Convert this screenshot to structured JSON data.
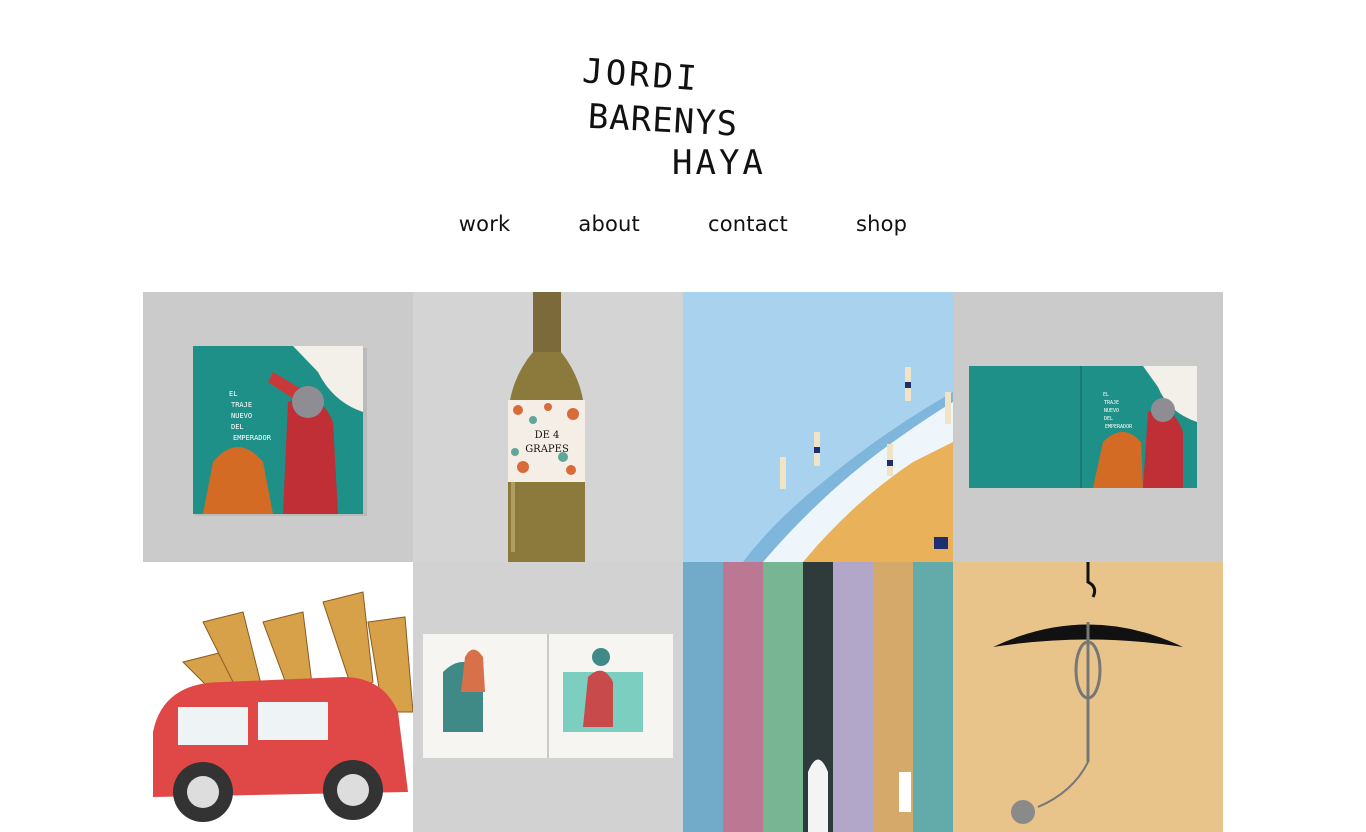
{
  "logo": {
    "lines": [
      "JORDI",
      "BARENYS",
      "HAYA"
    ]
  },
  "nav": {
    "items": [
      {
        "label": "work"
      },
      {
        "label": "about"
      },
      {
        "label": "contact"
      },
      {
        "label": "shop"
      }
    ]
  },
  "gallery": {
    "tiles": [
      {
        "subject": "book-cover-mockup",
        "text": [
          "EL",
          "TRAJE",
          "NUEVO",
          "DEL",
          "EMPERADOR"
        ]
      },
      {
        "subject": "wine-bottle-label",
        "text": [
          "DE 4",
          "GRAPES"
        ]
      },
      {
        "subject": "beach-illustration"
      },
      {
        "subject": "open-book-mockup",
        "text": [
          "EL",
          "TRAJE",
          "NUEVO",
          "DEL",
          "EMPERADOR"
        ]
      },
      {
        "subject": "giraffes-car-illustration"
      },
      {
        "subject": "open-book-spread"
      },
      {
        "subject": "letter-library-illustration"
      },
      {
        "subject": "hanger-noose-illustration"
      }
    ]
  },
  "colors": {
    "teal": "#1f9087",
    "gray_bg": "#cbcbcb",
    "sand": "#e9c48a",
    "red": "#d64a4a"
  }
}
